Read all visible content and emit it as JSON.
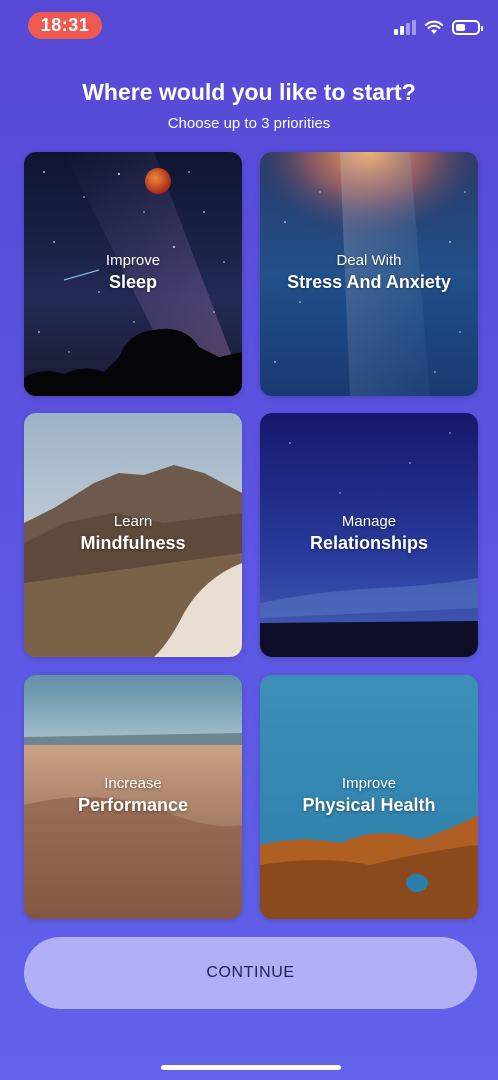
{
  "status_bar": {
    "time": "18:31",
    "icons": [
      "signal-icon",
      "wifi-icon",
      "battery-icon"
    ],
    "battery_level": 0.45
  },
  "header": {
    "title": "Where would you like to start?",
    "subtitle": "Choose up to 3 priorities"
  },
  "cards": [
    {
      "kicker": "Improve",
      "title": "Sleep"
    },
    {
      "kicker": "Deal With",
      "title": "Stress And Anxiety"
    },
    {
      "kicker": "Learn",
      "title": "Mindfulness"
    },
    {
      "kicker": "Manage",
      "title": "Relationships"
    },
    {
      "kicker": "Increase",
      "title": "Performance"
    },
    {
      "kicker": "Improve",
      "title": "Physical Health"
    }
  ],
  "continue_label": "CONTINUE",
  "colors": {
    "background_top": "#5649d6",
    "background_bottom": "#6262ea",
    "time_pill": "#ee5a4f",
    "continue_button": "#b2b0f4",
    "continue_text": "#23205e"
  }
}
